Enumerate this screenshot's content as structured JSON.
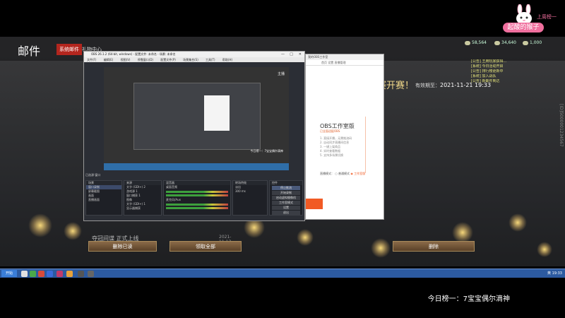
{
  "stream": {
    "ticker": "今日榜一：7宝宝偶尔滴神",
    "badge_label": "起酸的猴子",
    "badge_top": "上周榜一"
  },
  "game": {
    "title": "邮件",
    "tabs": [
      "系统邮件",
      "礼物中心"
    ],
    "banner": "动杯精英选拔赛决赛开赛！",
    "deadline_label": "有效期至：",
    "deadline_value": "2021-11-21 19:33",
    "mail_item": "夺冠间谍 正式上线",
    "mail_date": "2021-11-13",
    "buttons": {
      "delete_read": "删除已读",
      "claim_all": "领取全部",
      "delete": "删除"
    },
    "stats": [
      {
        "label": "弹药",
        "value": "58,564"
      },
      {
        "label": "金币",
        "value": "34,640"
      },
      {
        "label": "钻石",
        "value": "1,000"
      }
    ],
    "chat": [
      "[公告] 王牌玩家获得...",
      "[系统] 今日活动开启",
      "[公告] 排行榜更新中",
      "[系统] 加入战队",
      "[公告] 新邮件到达"
    ],
    "vertical_id": "[ID]5000001234567"
  },
  "obs": {
    "title": "OBS 26.1.2 (64-bit, windows) - 配置文件: 未命名 - 场景: 未命名",
    "menu": [
      "文件(F)",
      "编辑(E)",
      "视图(V)",
      "停靠窗口(D)",
      "配置文件(P)",
      "场景集合(S)",
      "工具(T)",
      "帮助(H)"
    ],
    "preview_label": "主播",
    "preview_caption": "今日榜一：7宝宝偶尔滴神",
    "status": "已选源:窗口",
    "scenes_title": "场景",
    "sources_title": "来源",
    "mixer_title": "混音器",
    "transitions_title": "转场特效",
    "controls_title": "控件",
    "scenes": [
      "窗口录制",
      "屏幕截图",
      "画面",
      "直播画面"
    ],
    "sources": [
      "文字 (GDI+) 2",
      "游戏源 1",
      "窗口捕获 1",
      "图像",
      "文字 (GDI+) 1",
      "显示器捕获"
    ],
    "mixer_channels": [
      "桌面音频",
      "麦克风/Aux"
    ],
    "transition_value": "淡出",
    "transition_duration": "300 ms",
    "controls": [
      "停止推流",
      "开始录制",
      "启动虚拟摄像机",
      "工作室模式",
      "设置",
      "退出"
    ]
  },
  "popup": {
    "window_title": "我的OBS工作室",
    "tabs": "首页  设置  直播管理",
    "heading": "OBS工作室版",
    "subheading": "已全面适配OBS",
    "description": [
      "1. 直接开播，无需推流码",
      "2. 自动同步直播间信息",
      "3. 一键上架商品",
      "4. 实时查看数据",
      "5. 支持多场景切换"
    ],
    "option_label": "直播模式：",
    "option_a": "普通模式",
    "option_b": "工作室版"
  },
  "taskbar": {
    "start_label": "开始",
    "tray_lang": "英",
    "clock": "19:33"
  }
}
